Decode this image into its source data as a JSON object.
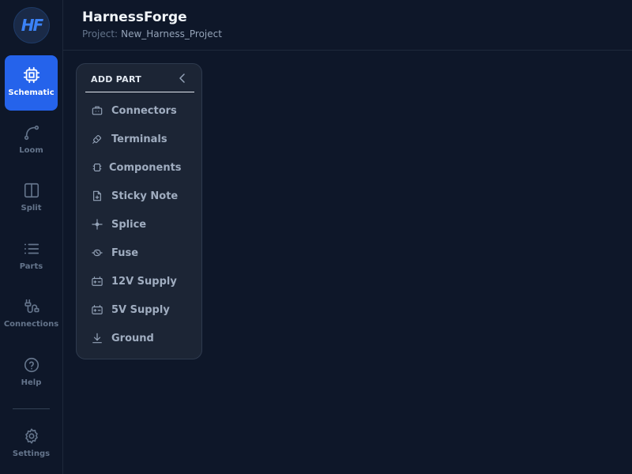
{
  "app": {
    "logo_text": "HF",
    "title": "HarnessForge",
    "project_label": "Project:",
    "project_name": "New_Harness_Project"
  },
  "sidebar": {
    "items": [
      {
        "id": "schematic",
        "label": "Schematic",
        "icon": "chip-icon",
        "active": true
      },
      {
        "id": "loom",
        "label": "Loom",
        "icon": "route-icon",
        "active": false
      },
      {
        "id": "split",
        "label": "Split",
        "icon": "columns-icon",
        "active": false
      },
      {
        "id": "parts",
        "label": "Parts",
        "icon": "list-icon",
        "active": false
      },
      {
        "id": "connections",
        "label": "Connections",
        "icon": "plug-icon",
        "active": false
      },
      {
        "id": "help",
        "label": "Help",
        "icon": "help-circle-icon",
        "active": false
      }
    ],
    "settings": {
      "label": "Settings",
      "icon": "gear-icon"
    }
  },
  "panel": {
    "title": "ADD PART",
    "items": [
      {
        "label": "Connectors",
        "icon": "connector-icon"
      },
      {
        "label": "Terminals",
        "icon": "terminal-icon"
      },
      {
        "label": "Components",
        "icon": "component-icon"
      },
      {
        "label": "Sticky Note",
        "icon": "note-icon"
      },
      {
        "label": "Splice",
        "icon": "splice-icon"
      },
      {
        "label": "Fuse",
        "icon": "fuse-icon"
      },
      {
        "label": "12V Supply",
        "icon": "battery-icon"
      },
      {
        "label": "5V Supply",
        "icon": "battery-icon"
      },
      {
        "label": "Ground",
        "icon": "ground-icon"
      }
    ]
  },
  "colors": {
    "background": "#0e1729",
    "accent": "#2563eb",
    "panel": "#1c2535"
  }
}
